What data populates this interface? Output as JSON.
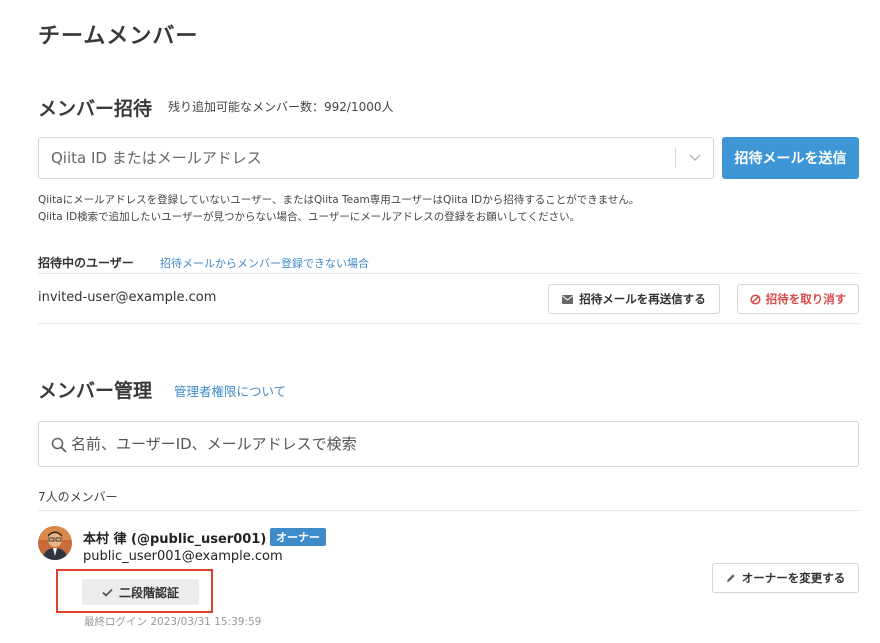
{
  "page_title": "チームメンバー",
  "invite": {
    "title": "メンバー招待",
    "remaining_text": "残り追加可能なメンバー数：992/1000人",
    "input_placeholder": "Qiita ID またはメールアドレス",
    "send_button": "招待メールを送信",
    "note_line1": "QiitaにメールアドレスQiitaにメールアドレスを登録していないユーザー、またはQiita Team専用ユーザーはQiita IDから招待することができません。",
    "note_line2": "Qiita ID検索で追加したいユーザーが見つからない場合、ユーザーにメールアドレスの登録をお願いしてください。"
  },
  "pending": {
    "title": "招待中のユーザー",
    "help_link": "招待メールからメンバー登録できない場合",
    "users": [
      {
        "email": "invited-user@example.com",
        "resend_label": "招待メールを再送信する",
        "cancel_label": "招待を取り消す"
      }
    ]
  },
  "management": {
    "title": "メンバー管理",
    "admin_link": "管理者権限について",
    "search_placeholder": "名前、ユーザーID、メールアドレスで検索",
    "member_count": "7人のメンバー",
    "members": [
      {
        "name": "本村 律 (@public_user001)",
        "role_badge": "オーナー",
        "email": "public_user001@example.com",
        "twofa_label": "二段階認証",
        "last_login": "最終ログイン 2023/03/31 15:39:59",
        "change_owner_label": "オーナーを変更する"
      }
    ]
  },
  "colors": {
    "primary": "#3e96d6",
    "link": "#3e8bc9",
    "danger": "#d94a4a",
    "highlight_border": "#e0412d"
  }
}
